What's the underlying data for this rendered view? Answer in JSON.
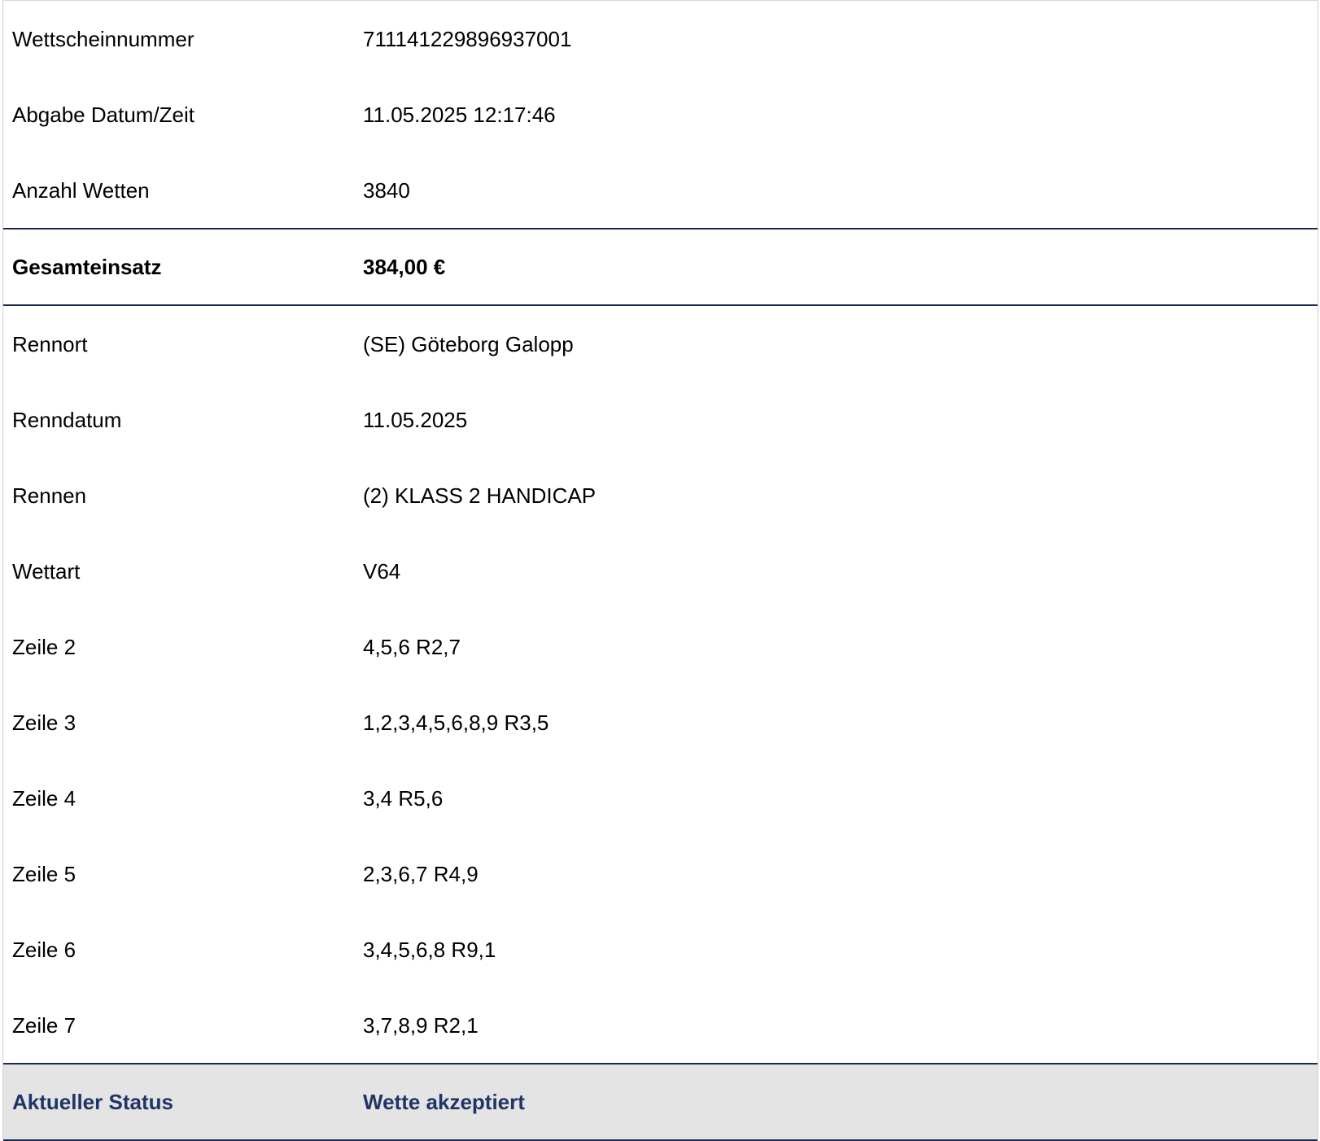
{
  "rows_top": [
    {
      "label": "Wettscheinnummer",
      "value": "711141229896937001"
    },
    {
      "label": "Abgabe Datum/Zeit",
      "value": "11.05.2025 12:17:46"
    },
    {
      "label": "Anzahl Wetten",
      "value": "3840"
    }
  ],
  "total": {
    "label": "Gesamteinsatz",
    "value": "384,00 €"
  },
  "rows_details": [
    {
      "label": "Rennort",
      "value": "(SE) Göteborg Galopp"
    },
    {
      "label": "Renndatum",
      "value": "11.05.2025"
    },
    {
      "label": "Rennen",
      "value": "(2) KLASS 2 HANDICAP"
    },
    {
      "label": "Wettart",
      "value": "V64"
    },
    {
      "label": "Zeile 2",
      "value": "4,5,6 R2,7"
    },
    {
      "label": "Zeile 3",
      "value": "1,2,3,4,5,6,8,9 R3,5"
    },
    {
      "label": "Zeile 4",
      "value": "3,4 R5,6"
    },
    {
      "label": "Zeile 5",
      "value": "2,3,6,7 R4,9"
    },
    {
      "label": "Zeile 6",
      "value": "3,4,5,6,8 R9,1"
    },
    {
      "label": "Zeile 7",
      "value": "3,7,8,9 R2,1"
    }
  ],
  "status": {
    "label": "Aktueller Status",
    "value": "Wette akzeptiert"
  },
  "colors": {
    "divider": "#1a2b4f",
    "status_text": "#1f3566",
    "status_background": "#e4e4e4"
  }
}
